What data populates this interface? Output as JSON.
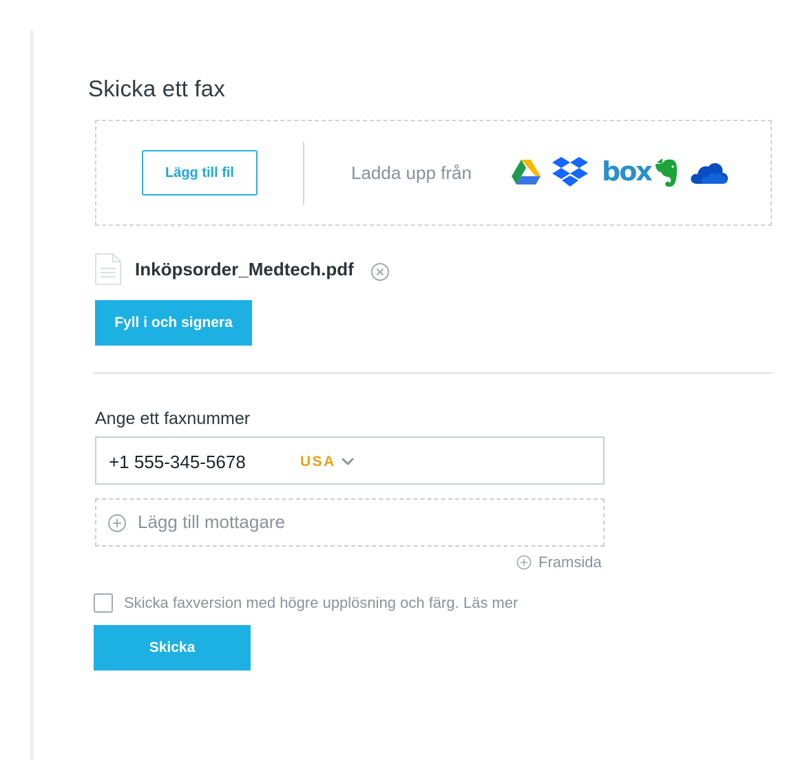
{
  "page": {
    "title": "Skicka ett fax"
  },
  "upload": {
    "add_file_label": "Lägg till fil",
    "upload_from_label": "Ladda upp från",
    "services": [
      {
        "name": "google-drive",
        "icon": "google-drive-icon"
      },
      {
        "name": "dropbox",
        "icon": "dropbox-icon"
      },
      {
        "name": "box",
        "icon": "box-icon",
        "logo_text": "box"
      },
      {
        "name": "evernote",
        "icon": "evernote-icon"
      },
      {
        "name": "onedrive",
        "icon": "onedrive-icon"
      }
    ]
  },
  "attachment": {
    "file_name": "Inköpsorder_Medtech.pdf",
    "file_icon": "document-icon",
    "remove_icon": "close-circle-icon"
  },
  "fill_sign": {
    "label": "Fyll i och signera"
  },
  "fax": {
    "label": "Ange ett faxnummer",
    "number": "+1 555-345-5678",
    "country": "USA",
    "dropdown_icon": "chevron-down-icon"
  },
  "recipients": {
    "add_label": "Lägg till mottagare",
    "icon": "plus-circle-icon"
  },
  "cover_page": {
    "label": "Framsida",
    "icon": "plus-circle-icon"
  },
  "high_res": {
    "checked": false,
    "text": "Skicka faxversion med högre upplösning och färg.",
    "read_more": "Läs mer"
  },
  "send": {
    "label": "Skicka"
  },
  "colors": {
    "accent": "#1cb0e3",
    "country_code": "#e7a215",
    "muted_text": "#8c9298",
    "border": "#c9ced3"
  }
}
